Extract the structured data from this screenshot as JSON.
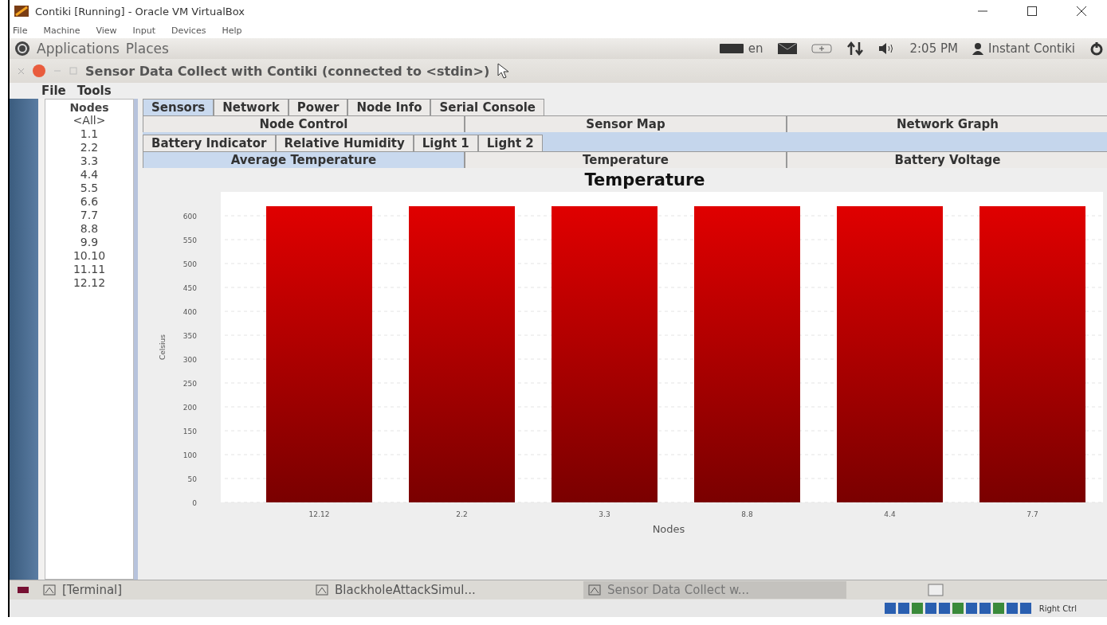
{
  "host_window": {
    "title": "Contiki [Running] - Oracle VM VirtualBox"
  },
  "host_menu": [
    "File",
    "Machine",
    "View",
    "Input",
    "Devices",
    "Help"
  ],
  "top_panel": {
    "menus": [
      "Applications",
      "Places"
    ],
    "language": "en",
    "time": "2:05 PM",
    "user": "Instant Contiki"
  },
  "app_window": {
    "title": "Sensor Data Collect with Contiki (connected to <stdin>)"
  },
  "app_menu": [
    "File",
    "Tools"
  ],
  "nodes": {
    "header": "Nodes",
    "items": [
      "<All>",
      "1.1",
      "2.2",
      "3.3",
      "4.4",
      "5.5",
      "6.6",
      "7.7",
      "8.8",
      "9.9",
      "10.10",
      "11.11",
      "12.12"
    ]
  },
  "tab_rows": [
    [
      {
        "label": "Sensors",
        "selected": true
      },
      {
        "label": "Network",
        "selected": false
      },
      {
        "label": "Power",
        "selected": false
      },
      {
        "label": "Node Info",
        "selected": false
      },
      {
        "label": "Serial Console",
        "selected": false
      }
    ],
    [
      {
        "label": "Node Control",
        "selected": false
      },
      {
        "label": "Sensor Map",
        "selected": false
      },
      {
        "label": "Network Graph",
        "selected": false
      }
    ]
  ],
  "sensor_tab_rows": [
    [
      {
        "label": "Battery Indicator",
        "selected": false
      },
      {
        "label": "Relative Humidity",
        "selected": false
      },
      {
        "label": "Light 1",
        "selected": false
      },
      {
        "label": "Light 2",
        "selected": false
      }
    ],
    [
      {
        "label": "Average Temperature",
        "selected": true
      },
      {
        "label": "Temperature",
        "selected": false
      },
      {
        "label": "Battery Voltage",
        "selected": false
      }
    ]
  ],
  "chart": {
    "chart_data": {
      "type": "bar",
      "title": "Temperature",
      "xlabel": "Nodes",
      "ylabel": "Celsius",
      "categories": [
        "12.12",
        "2.2",
        "3.3",
        "8.8",
        "4.4",
        "7.7"
      ],
      "series": [
        {
          "color": "#e00000",
          "values": [
            620,
            620,
            620,
            620,
            620,
            620
          ]
        }
      ],
      "grid": true,
      "ylim": [
        0,
        650
      ],
      "yticks": [
        0,
        50,
        100,
        150,
        200,
        250,
        300,
        350,
        400,
        450,
        500,
        550,
        600
      ]
    }
  },
  "taskbar": [
    {
      "label": "[Terminal]",
      "selected": false
    },
    {
      "label": "BlackholeAttackSimul...",
      "selected": false
    },
    {
      "label": "Sensor Data Collect w...",
      "selected": true
    }
  ],
  "status_bar": {
    "host_key": "Right Ctrl"
  }
}
